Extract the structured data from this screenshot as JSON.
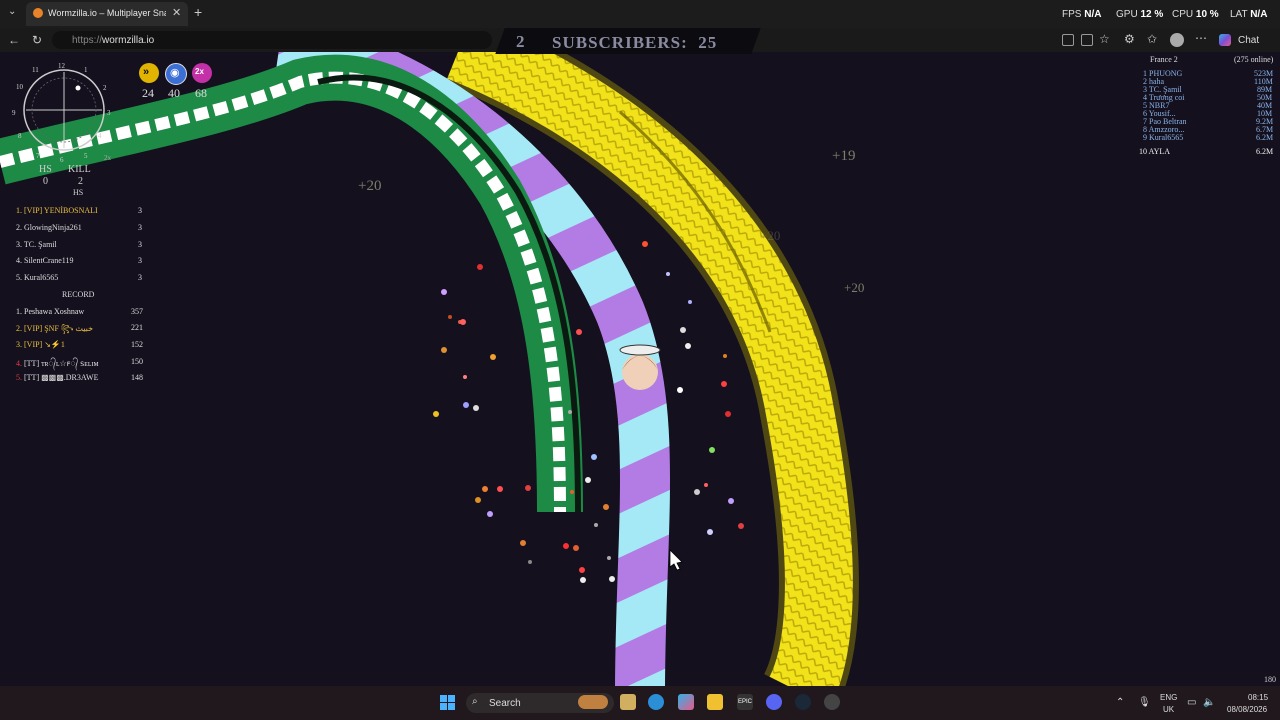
{
  "browser": {
    "tab_title": "Wormzilla.io – Multiplayer Snake G",
    "url_scheme": "https://",
    "url_host": "wormzilla.io",
    "chat_label": "Chat",
    "perf": {
      "fps_label": "FPS",
      "fps_value": "N/A",
      "gpu_label": "GPU",
      "gpu_value": "12 %",
      "cpu_label": "CPU",
      "cpu_value": "10 %",
      "lat_label": "LAT",
      "lat_value": "N/A"
    }
  },
  "game": {
    "subscribers_num": "2",
    "subscribers_text": "SUBSCRIBERS:",
    "subscribers_count": "25",
    "powerups": [
      {
        "icon": "speed-icon",
        "value": "24",
        "color": "#e0b400"
      },
      {
        "icon": "magnet-icon",
        "value": "40",
        "color": "#3b6fd6"
      },
      {
        "icon": "double-icon",
        "value": "68",
        "color": "#c430a8"
      }
    ],
    "stats": {
      "hs_label": "HS",
      "hs_value": "0",
      "kill_label": "KILL",
      "kill_value": "2",
      "sub_label": "HS"
    },
    "minimap_numbers": [
      "11",
      "12",
      "1",
      "2",
      "3",
      "9",
      "10",
      "4",
      "5",
      "6",
      "7",
      "8",
      "2x"
    ],
    "hs_leaderboard": [
      {
        "rank": "1.",
        "name": "[VIP] YENİBOSNALI",
        "score": "3"
      },
      {
        "rank": "2.",
        "name": "GlowingNinja261",
        "score": "3"
      },
      {
        "rank": "3.",
        "name": "TC. Şamil",
        "score": "3"
      },
      {
        "rank": "4.",
        "name": "SilentCrane119",
        "score": "3"
      },
      {
        "rank": "5.",
        "name": "Kural6565",
        "score": "3"
      }
    ],
    "record_label": "RECORD",
    "record_leaderboard": [
      {
        "rank": "1.",
        "name": "Peshawa Xoshnaw",
        "score": "357",
        "color": "#e0e0e0"
      },
      {
        "rank": "2.",
        "name": "[VIP] ŞNF ꧂ خبيث",
        "score": "221",
        "color": "#e8c040"
      },
      {
        "rank": "3.",
        "name": "[VIP] ↘⚡1",
        "score": "152",
        "color": "#e8c040"
      },
      {
        "rank": "4.",
        "name": "[TT] ᴛʀ᭄ʟ☆ꜰ᭄ ꜱᴇʟɪᴍ",
        "score": "150",
        "color": "#e04040"
      },
      {
        "rank": "5.",
        "name": "[TT] ▩▩▩.DR3AWE",
        "score": "148",
        "color": "#e04040"
      }
    ],
    "server": {
      "name": "France 2",
      "online": "(275 online)"
    },
    "top_players": [
      {
        "rank": "1",
        "name": "PHUONG",
        "score": "523M"
      },
      {
        "rank": "2",
        "name": "haha",
        "score": "110M"
      },
      {
        "rank": "3",
        "name": "TC. Şamil",
        "score": "89M"
      },
      {
        "rank": "4",
        "name": "Trương coi",
        "score": "50M"
      },
      {
        "rank": "5",
        "name": "NBR7",
        "score": "40M"
      },
      {
        "rank": "6",
        "name": "Yousif...",
        "score": "10M"
      },
      {
        "rank": "7",
        "name": "Pao Beltran",
        "score": "9.2M"
      },
      {
        "rank": "8",
        "name": "Amzzoro...",
        "score": "6.7M"
      },
      {
        "rank": "9",
        "name": "Kural6565",
        "score": "6.2M"
      }
    ],
    "self_rank": {
      "rank": "10",
      "name": "AYLA",
      "score": "6.2M"
    },
    "floating_scores": [
      "+20",
      "+19",
      "+20",
      "+20"
    ],
    "corner_number": "180"
  },
  "taskbar": {
    "search_label": "Search",
    "lang_top": "ENG",
    "lang_bottom": "UK",
    "time": "08:15",
    "date": "08/08/2026"
  },
  "colors": {
    "game_bg": "#14101e",
    "yellow_snake": "#f2e21a",
    "green_snake": "#1d8a45",
    "purple_snake": "#b47ae0",
    "cyan_snake": "#9fe6f4"
  }
}
